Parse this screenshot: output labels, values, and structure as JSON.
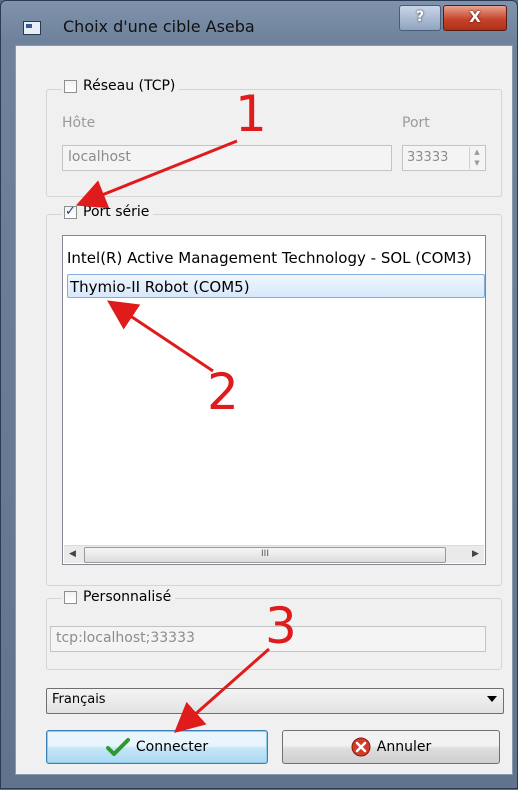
{
  "window": {
    "title": "Choix d'une cible Aseba",
    "help_label": "?",
    "close_label": "X"
  },
  "network": {
    "checkbox_label": "Réseau (TCP)",
    "host_label": "Hôte",
    "host_value": "localhost",
    "port_label": "Port",
    "port_value": "33333"
  },
  "serial": {
    "checkbox_label": "Port série",
    "items": [
      {
        "label": "Intel(R) Active Management Technology - SOL (COM3)"
      },
      {
        "label": "Thymio-II Robot (COM5)"
      }
    ],
    "scroll_thumb_glyph": "III"
  },
  "custom": {
    "checkbox_label": "Personnalisé",
    "value": "tcp:localhost;33333"
  },
  "language": {
    "selected": "Français"
  },
  "buttons": {
    "connect_label": "Connecter",
    "cancel_label": "Annuler"
  },
  "annotations": {
    "a1": "1",
    "a2": "2",
    "a3": "3",
    "color": "#e01b1b"
  },
  "colors": {
    "titlebar": "#6e829c",
    "dialog_bg": "#f0f0f0",
    "default_button": "#c4e5f6",
    "close_button": "#c5452b",
    "checkmark": "#2e9a2e"
  }
}
